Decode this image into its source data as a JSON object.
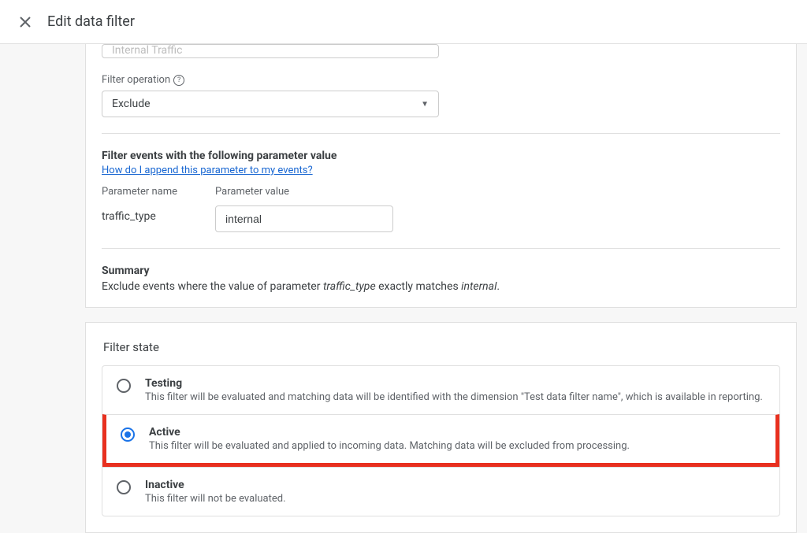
{
  "header": {
    "title": "Edit data filter"
  },
  "card1": {
    "truncated_field": "Internal Traffic",
    "filter_operation_label": "Filter operation",
    "filter_operation_value": "Exclude",
    "filter_events_title": "Filter events with the following parameter value",
    "help_link": "How do I append this parameter to my events?",
    "param_name_label": "Parameter name",
    "param_value_label": "Parameter value",
    "param_name": "traffic_type",
    "param_value": "internal",
    "summary_label": "Summary",
    "summary_prefix": "Exclude events where the value of parameter ",
    "summary_param": "traffic_type",
    "summary_mid": " exactly matches ",
    "summary_val": "internal",
    "summary_suffix": "."
  },
  "card2": {
    "title": "Filter state",
    "options": [
      {
        "label": "Testing",
        "desc": "This filter will be evaluated and matching data will be identified with the dimension \"Test data filter name\", which is available in reporting.",
        "selected": false
      },
      {
        "label": "Active",
        "desc": "This filter will be evaluated and applied to incoming data. Matching data will be excluded from processing.",
        "selected": true
      },
      {
        "label": "Inactive",
        "desc": "This filter will not be evaluated.",
        "selected": false
      }
    ]
  }
}
